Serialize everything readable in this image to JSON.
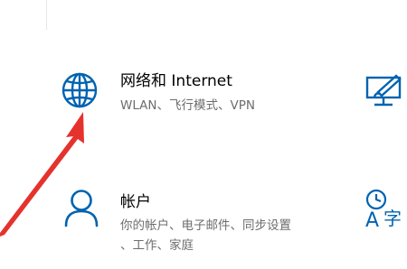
{
  "colors": {
    "accent": "#0063b1",
    "annotation_arrow": "#e5322d",
    "desc_text": "#6d6d6d"
  },
  "tiles": [
    {
      "title": "网络和 Internet",
      "description_line1": "WLAN、飞行模式、VPN",
      "icon": "globe-icon"
    },
    {
      "title": "帐户",
      "description_line1": "你的帐户、电子邮件、同步设置",
      "description_line2": "、工作、家庭",
      "icon": "person-icon"
    }
  ],
  "right_column_icons": [
    "personalization-icon",
    "time-language-icon"
  ],
  "time_language_glyphs": {
    "letter": "A",
    "char": "字"
  },
  "annotation": {
    "type": "arrow",
    "points_to": "network-internet-tile"
  }
}
